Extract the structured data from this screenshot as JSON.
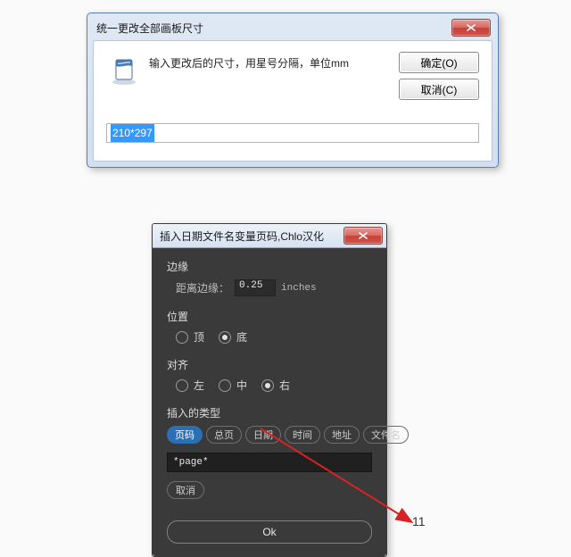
{
  "dialog1": {
    "title": "统一更改全部画板尺寸",
    "message": "输入更改后的尺寸，用星号分隔，单位mm",
    "ok_label": "确定(O)",
    "cancel_label": "取消(C)",
    "input_value": "210*297"
  },
  "dialog2": {
    "title": "插入日期文件名变量页码,Chlo汉化",
    "margin": {
      "group": "边缘",
      "label": "距离边缘：",
      "value": "0.25",
      "unit": "inches"
    },
    "position": {
      "group": "位置",
      "options": [
        "顶",
        "底"
      ],
      "selected": 1
    },
    "align": {
      "group": "对齐",
      "options": [
        "左",
        "中",
        "右"
      ],
      "selected": 2
    },
    "insert": {
      "group": "插入的类型",
      "pills": [
        "页码",
        "总页",
        "日期",
        "时间",
        "地址",
        "文件名"
      ],
      "active": 0,
      "code": "*page*",
      "cancel": "取消"
    },
    "ok": "Ok"
  },
  "page_number": "11"
}
